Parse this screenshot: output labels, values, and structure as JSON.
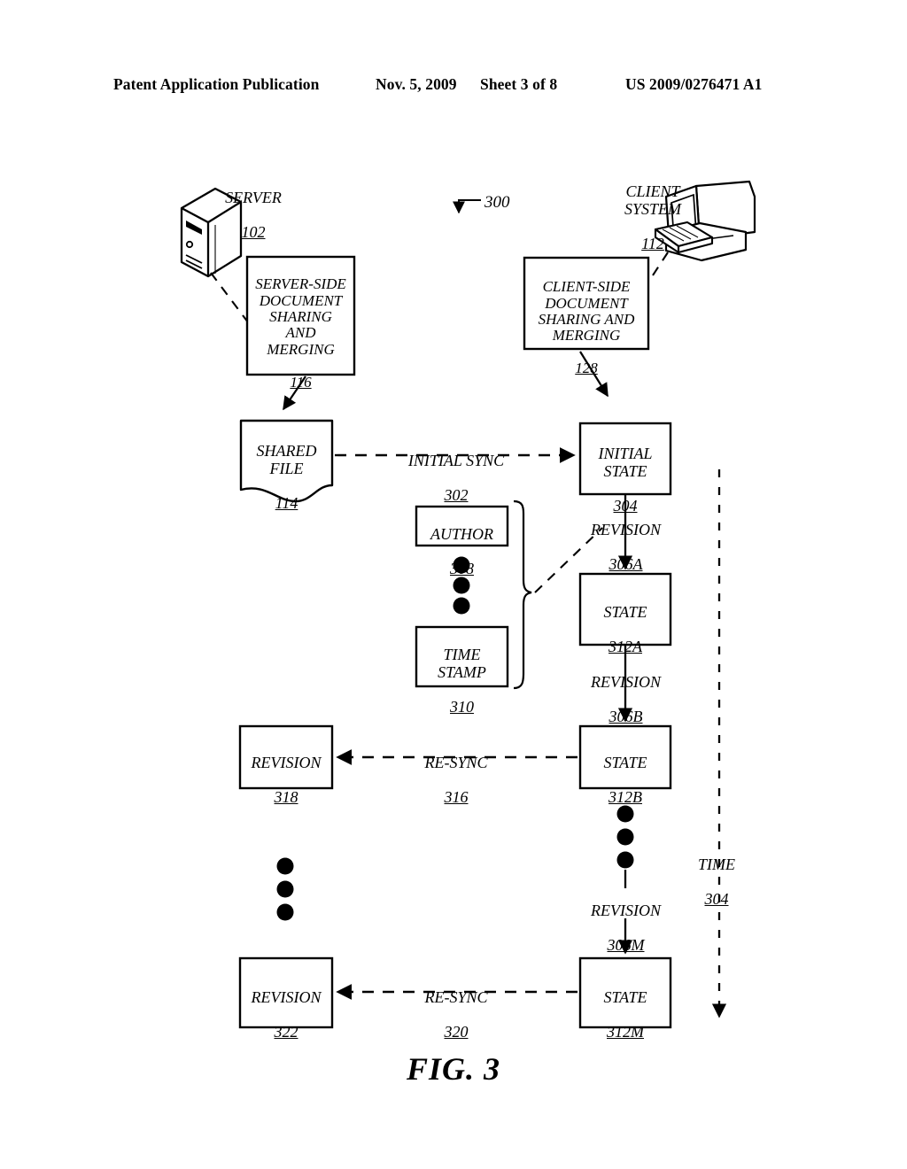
{
  "header": {
    "publication": "Patent Application Publication",
    "date": "Nov. 5, 2009",
    "sheet": "Sheet 3 of 8",
    "patent_number": "US 2009/0276471 A1"
  },
  "figure": {
    "caption": "FIG. 3",
    "diagram_ref": "300"
  },
  "devices": {
    "server": {
      "label": "SERVER",
      "ref": "102",
      "icon": "server-tower-icon"
    },
    "client": {
      "label": "CLIENT\nSYSTEM",
      "ref": "112",
      "icon": "desktop-computer-icon"
    }
  },
  "modules": {
    "server_side": {
      "label": "SERVER-SIDE\nDOCUMENT\nSHARING\nAND\nMERGING",
      "ref": "116"
    },
    "client_side": {
      "label": "CLIENT-SIDE\nDOCUMENT\nSHARING AND\nMERGING",
      "ref": "128"
    }
  },
  "nodes": {
    "shared_file": {
      "label": "SHARED\nFILE",
      "ref": "114"
    },
    "initial_state": {
      "label": "INITIAL\nSTATE",
      "ref": "304"
    },
    "author": {
      "label": "AUTHOR",
      "ref": "308"
    },
    "time_stamp": {
      "label": "TIME\nSTAMP",
      "ref": "310"
    },
    "state_a": {
      "label": "STATE",
      "ref": "312A"
    },
    "state_b": {
      "label": "STATE",
      "ref": "312B"
    },
    "state_m": {
      "label": "STATE",
      "ref": "312M"
    },
    "revision_318": {
      "label": "REVISION",
      "ref": "318"
    },
    "revision_322": {
      "label": "REVISION",
      "ref": "322"
    }
  },
  "edges": {
    "initial_sync": {
      "label": "INITIAL SYNC",
      "ref": "302"
    },
    "revision_a": {
      "label": "REVISION",
      "ref": "306A"
    },
    "revision_b": {
      "label": "REVISION",
      "ref": "306B"
    },
    "revision_m": {
      "label": "REVISION",
      "ref": "306M"
    },
    "resync_316": {
      "label": "RE-SYNC",
      "ref": "316"
    },
    "resync_320": {
      "label": "RE-SYNC",
      "ref": "320"
    }
  },
  "axis": {
    "time": {
      "label": "TIME",
      "ref": "304"
    }
  },
  "colors": {
    "ink": "#000000",
    "paper": "#ffffff"
  }
}
